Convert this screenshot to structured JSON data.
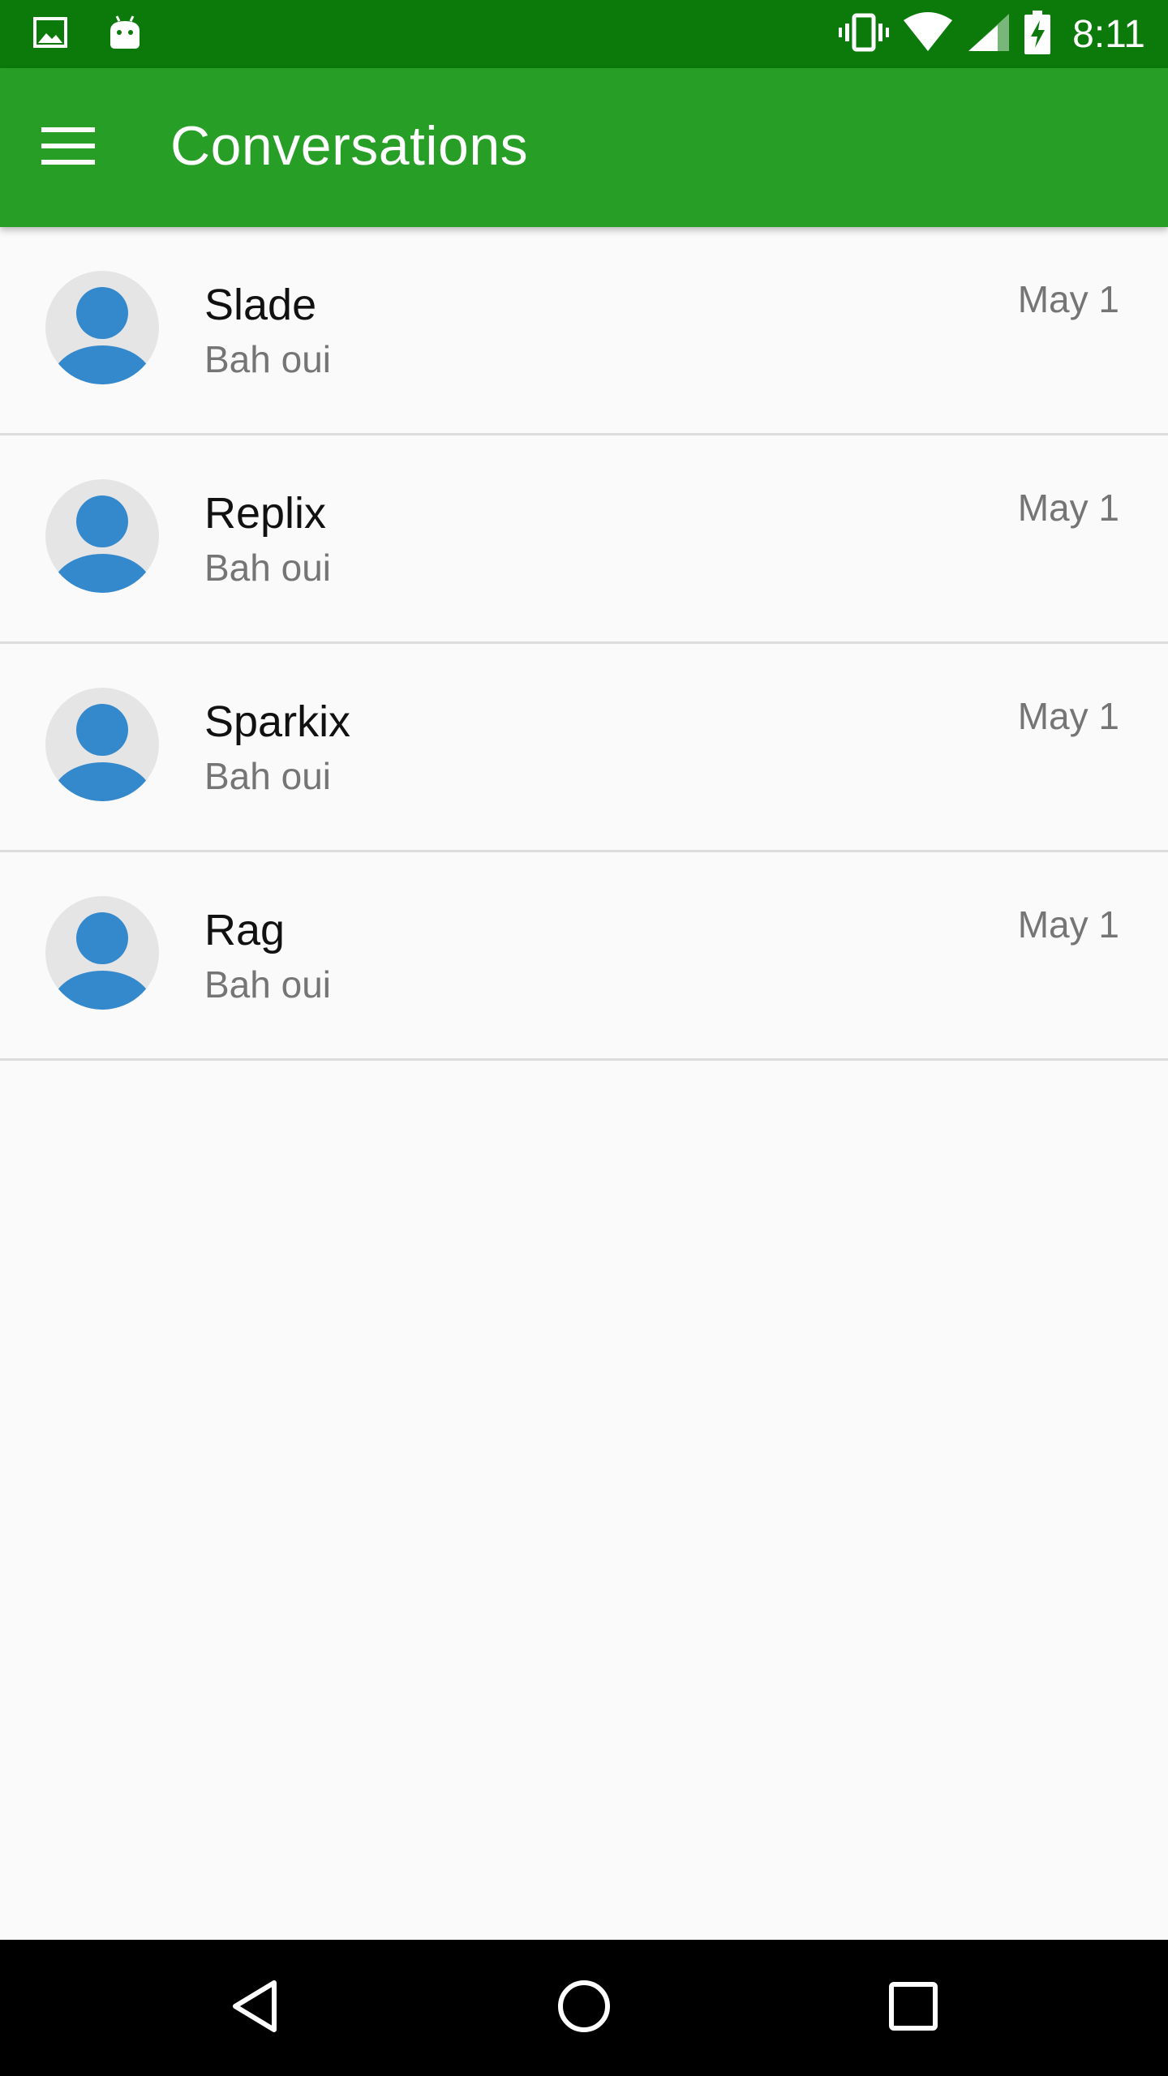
{
  "status_bar": {
    "time": "8:11",
    "left_icons": [
      "image-notification-icon",
      "android-notification-icon"
    ],
    "right_icons": [
      "vibrate-icon",
      "wifi-icon",
      "cell-signal-icon",
      "battery-charging-icon"
    ]
  },
  "app_bar": {
    "title": "Conversations",
    "menu_icon": "hamburger-menu-icon"
  },
  "conversations": [
    {
      "name": "Slade",
      "preview": "Bah oui",
      "date": "May 1"
    },
    {
      "name": "Replix",
      "preview": "Bah oui",
      "date": "May 1"
    },
    {
      "name": "Sparkix",
      "preview": "Bah oui",
      "date": "May 1"
    },
    {
      "name": "Rag",
      "preview": "Bah oui",
      "date": "May 1"
    }
  ],
  "nav_bar": {
    "buttons": [
      "back-icon",
      "home-icon",
      "recents-icon"
    ]
  },
  "colors": {
    "status_bar": "#0b7a0b",
    "app_bar": "#279f27",
    "avatar_bg": "#e5e5e5",
    "avatar_fg": "#3488cc",
    "background": "#fafafa"
  }
}
